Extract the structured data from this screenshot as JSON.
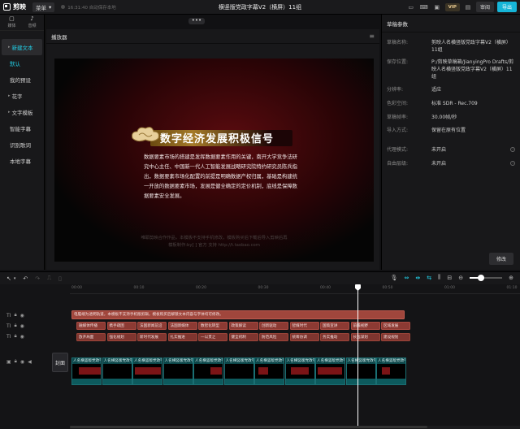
{
  "app": {
    "logo_text": "剪映",
    "menu_label": "菜单",
    "autosave": "16:31:40 自动保存本地",
    "window_title": "横竖版党政字幕V2（横屏）11组",
    "vip_label": "VIP",
    "review_label": "审阅",
    "export_label": "导出"
  },
  "media_tabs": [
    {
      "label": "媒体",
      "icon": "media-icon"
    },
    {
      "label": "音频",
      "icon": "audio-icon"
    }
  ],
  "sidebar": {
    "items": [
      {
        "label": "新建文本",
        "type": "group-active"
      },
      {
        "label": "默认",
        "type": "sub-active"
      },
      {
        "label": "我的预设",
        "type": "sub"
      },
      {
        "label": "花字",
        "type": "group"
      },
      {
        "label": "文字模板",
        "type": "group"
      },
      {
        "label": "智能字幕",
        "type": "item"
      },
      {
        "label": "识别歌词",
        "type": "item"
      },
      {
        "label": "本地字幕",
        "type": "item"
      }
    ]
  },
  "player": {
    "title": "播放器",
    "grabber": "•••",
    "headline": "数字经济发展积极信号",
    "body": "数据要素市场的搭建是发挥数据要素作用的关键，南开大学竞争法研究中心主任、中国新一代人工智能发展战略研究院特约研究员陈兵指出，数据要素市场化配置的前提是明确数据产权归属，基础是构建统一开放的数据要素市场，发展是健全确定的定价机制，底线是保障数据要素安全发展。",
    "watermark_1": "唯耶剪映合作作品，本模板不支持手机修改，模板购买后下载后导入剪映后再",
    "watermark_2": "模板制作:by[  ] 官方   支持 http://t.taobao.com"
  },
  "params": {
    "title": "草稿参数",
    "rows": [
      {
        "label": "草稿名称:",
        "value": "剪映人名横竖版党政字幕V2（横屏）11组",
        "info": false
      },
      {
        "label": "保存位置:",
        "value": "P:/剪映草稿箱/JianyingPro Drafts/剪映人名横竖版党政字幕V2（横屏）11组",
        "info": false
      },
      {
        "label": "分辨率:",
        "value": "适应",
        "info": false
      },
      {
        "label": "色彩空间:",
        "value": "标准 SDR - Rec.709",
        "info": false
      },
      {
        "label": "草稿帧率:",
        "value": "30.00帧/秒",
        "info": false
      },
      {
        "label": "导入方式:",
        "value": "保留在原有位置",
        "info": false
      },
      {
        "label": "代理模式:",
        "value": "未开启",
        "info": true
      },
      {
        "label": "自由层级:",
        "value": "未开启",
        "info": true
      }
    ],
    "modify_label": "修改"
  },
  "timeline": {
    "ruler_labels": [
      "00:00",
      "00:10",
      "00:20",
      "00:30",
      "00:40",
      "00:50",
      "01:00",
      "01:10"
    ],
    "cover_label": "封面",
    "note_clip": "电脑端为透明轨道，本模板不支持手机版剪辑，模板购买后解锁文本内容与字体均可修改。",
    "text_track_1": [
      "融媒体传播",
      "携手疏困",
      "法国新闻前沿",
      "法国新媒体",
      "数智化转型",
      "政策解读",
      "创新驱动",
      "智媒时代",
      "国策宣讲",
      "前瞻视野",
      "区域发展"
    ],
    "text_track_2": [
      "放开局面",
      "强化规划",
      "新时代发展",
      "扎实推进",
      "一以贯之",
      "健全机制",
      "防范风险",
      "统筹协调",
      "务实推动",
      "长远谋划",
      "建设规划"
    ],
    "video_clip_label": "人名横竖版党政字幕",
    "zoom_percent": 35
  }
}
